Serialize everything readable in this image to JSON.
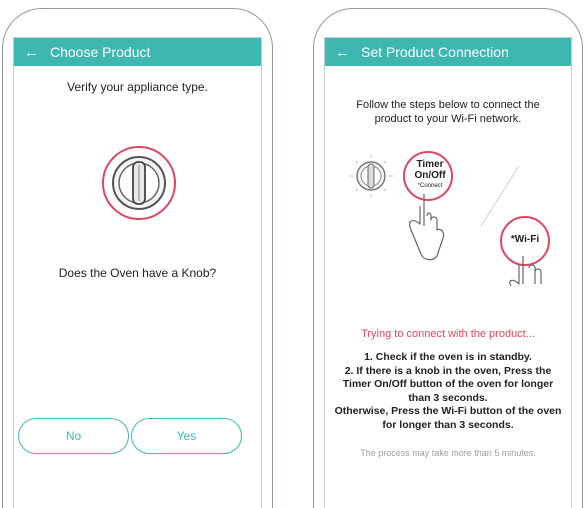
{
  "left_screen": {
    "title": "Choose Product",
    "back_icon": "arrow-left-icon",
    "prompt": "Verify your appliance type.",
    "knob_icon": "oven-knob-icon",
    "question": "Does the Oven have a Knob?",
    "no_label": "No",
    "yes_label": "Yes"
  },
  "right_screen": {
    "title": "Set Product Connection",
    "back_icon": "arrow-left-icon",
    "instructions_line1": "Follow the steps below to connect the",
    "instructions_line2": "product to your Wi-Fi network.",
    "timer_label_line1": "Timer",
    "timer_label_line2": "On/Off",
    "timer_sub": "*Connect",
    "wifi_label": "*Wi-Fi",
    "status": "Trying to connect with the product...",
    "step1": "1. Check if the oven is in standby.",
    "step2_line1": "2. If there is a knob in the oven, Press the",
    "step2_line2": "Timer On/Off button of the oven for longer",
    "step2_line3": "than 3 seconds.",
    "step2_line4": "Otherwise, Press the Wi-Fi button of the oven",
    "step2_line5": "for longer than 3 seconds.",
    "note": "The process may take more than 5 minutes."
  },
  "colors": {
    "teal": "#3fb7b1",
    "accent_red": "#e2445f"
  }
}
